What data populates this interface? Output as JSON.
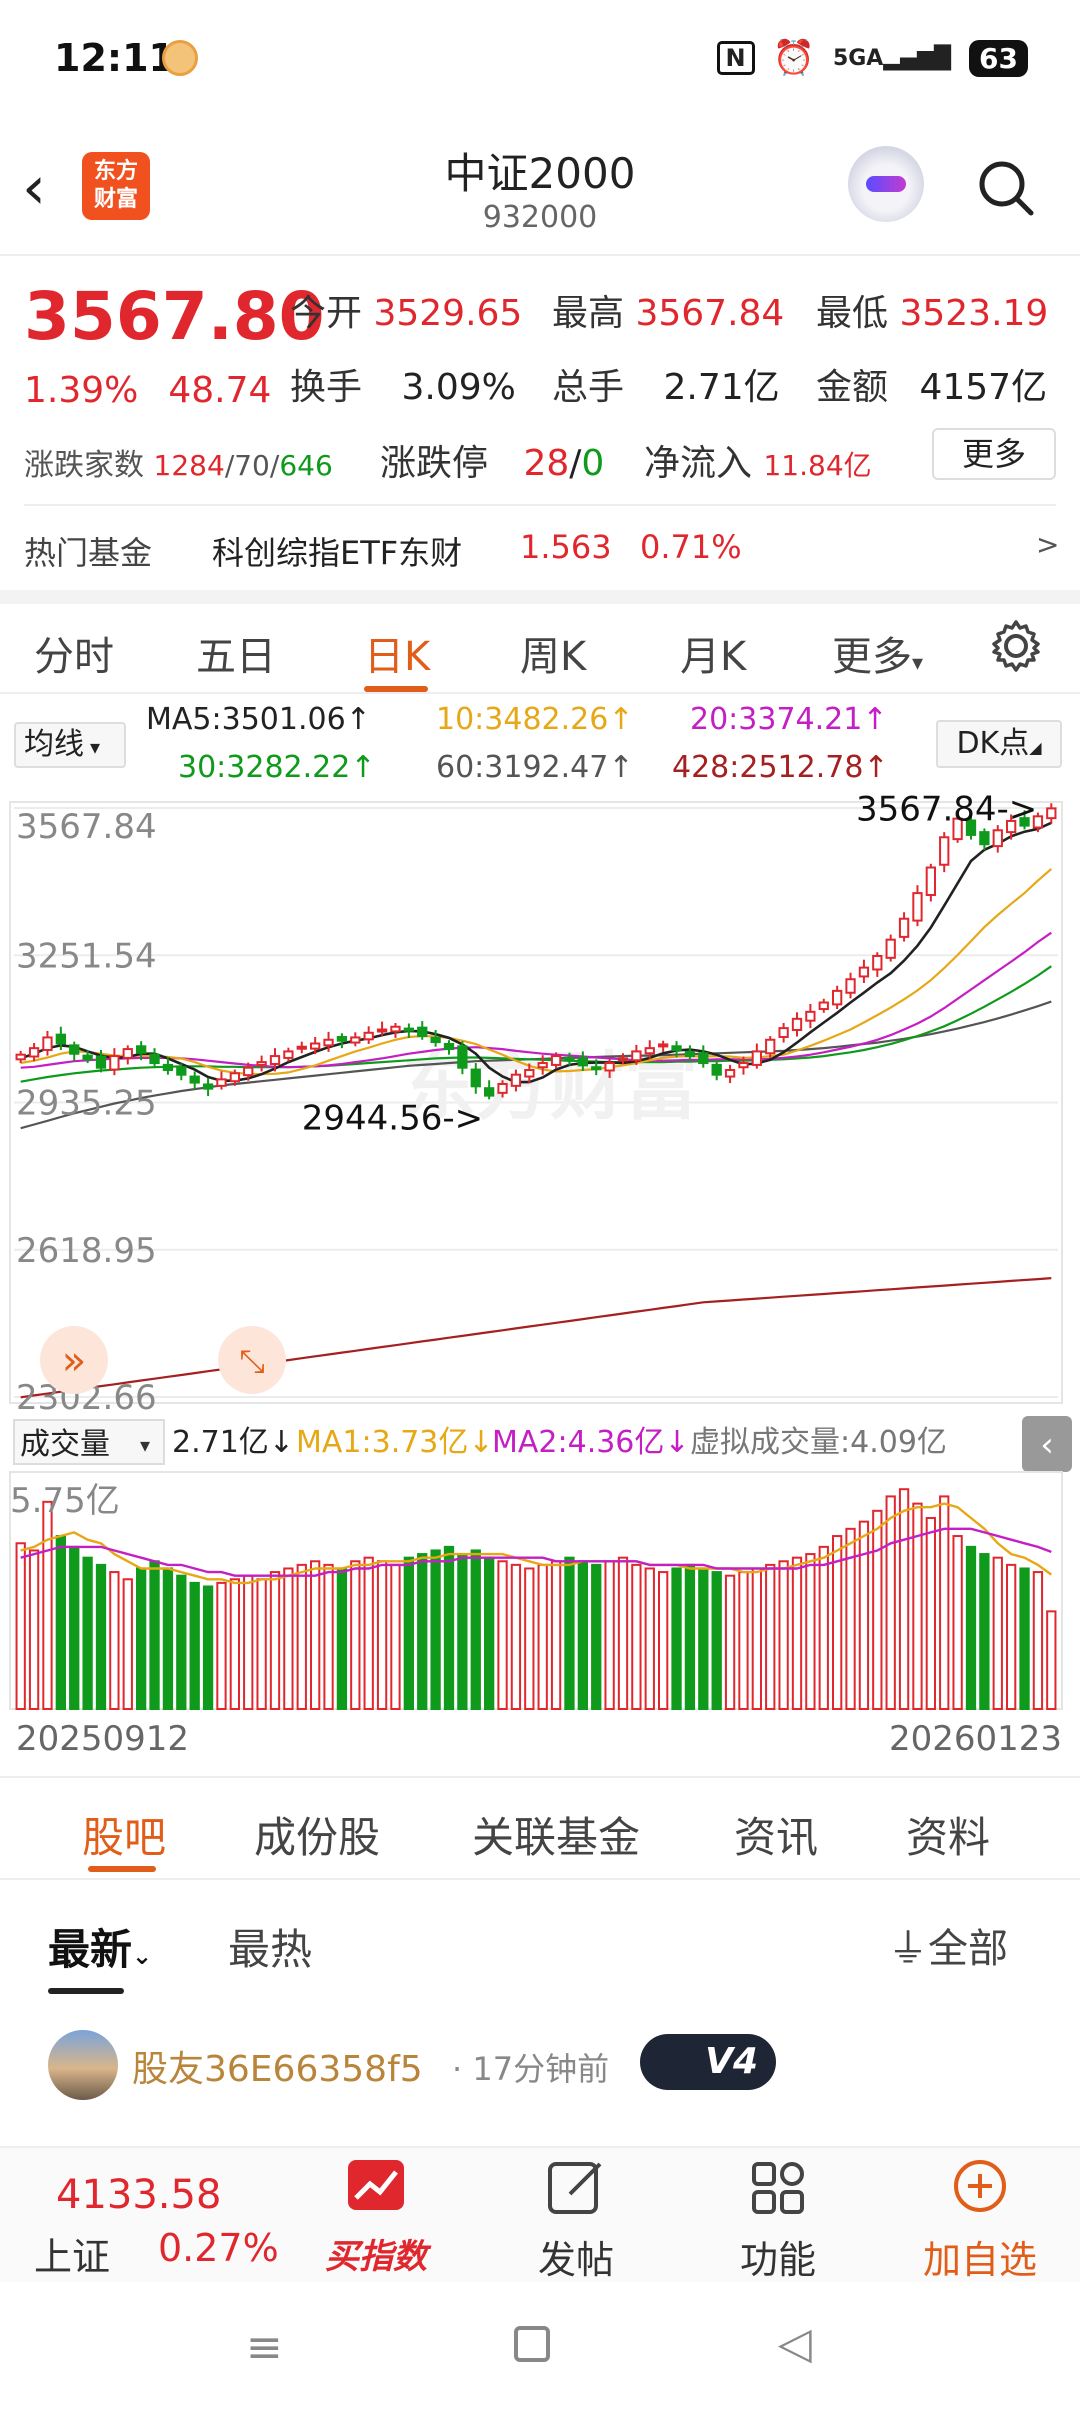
{
  "status_bar": {
    "time": "12:11",
    "icons": [
      "nfc-icon",
      "alarm-icon",
      "5g-signal-icon"
    ],
    "signal_label": "5GA",
    "battery": "63"
  },
  "header": {
    "title": "中证2000",
    "code": "932000",
    "logo_text_line1": "东方",
    "logo_text_line2": "财富"
  },
  "quote": {
    "price": "3567.80",
    "change_pct": "1.39%",
    "change_abs": "48.74",
    "open_label": "今开",
    "open": "3529.65",
    "high_label": "最高",
    "high": "3567.84",
    "low_label": "最低",
    "low": "3523.19",
    "turnover_label": "换手",
    "turnover": "3.09%",
    "volume_label": "总手",
    "volume": "2.71亿",
    "amount_label": "金额",
    "amount": "4157亿",
    "breadth_label": "涨跌家数",
    "breadth_up": "1284",
    "breadth_flat": "/70/",
    "breadth_down": "646",
    "limit_label": "涨跌停",
    "limit_up": "28",
    "limit_sep": "/",
    "limit_down": "0",
    "netflow_label": "净流入",
    "netflow": "11.84亿",
    "more_button": "更多"
  },
  "hot_fund": {
    "label": "热门基金",
    "name": "科创综指ETF东财",
    "price": "1.563",
    "change": "0.71%",
    "arrow": ">"
  },
  "chart_tabs": [
    {
      "label": "分时",
      "active": false
    },
    {
      "label": "五日",
      "active": false
    },
    {
      "label": "日K",
      "active": true
    },
    {
      "label": "周K",
      "active": false
    },
    {
      "label": "月K",
      "active": false
    },
    {
      "label": "更多",
      "active": false
    }
  ],
  "ma_row": {
    "select": "均线",
    "ma5": "MA5:3501.06↑",
    "ma10": "10:3482.26↑",
    "ma20": "20:3374.21↑",
    "ma30": "30:3282.22↑",
    "ma60": "60:3192.47↑",
    "ma428": "428:2512.78↑",
    "dk_button": "DK点",
    "colors": {
      "ma5": "#222222",
      "ma10": "#e6a817",
      "ma20": "#c41fc4",
      "ma30": "#0f9a1c",
      "ma60": "#555555",
      "ma428": "#a52020"
    }
  },
  "volume_row": {
    "select": "成交量",
    "vol": "2.71亿↓",
    "ma1": "MA1:3.73亿↓",
    "ma2": "MA2:4.36亿↓",
    "virtual": "虚拟成交量:4.09亿"
  },
  "chart_data": {
    "type": "candlestick",
    "y_ticks": [
      "3567.84",
      "3251.54",
      "2935.25",
      "2618.95",
      "2302.66"
    ],
    "ylim": [
      2302.66,
      3567.84
    ],
    "x_start": "20250912",
    "x_end": "20260123",
    "max_marker": "3567.84->",
    "min_marker": "2944.56->",
    "volume_max_label": "5.75亿",
    "watermark": "东方财富",
    "closes": [
      3038,
      3052,
      3075,
      3062,
      3040,
      3028,
      3010,
      3035,
      3050,
      3042,
      3020,
      3005,
      2995,
      2978,
      2965,
      2985,
      2998,
      3010,
      3022,
      3035,
      3045,
      3055,
      3062,
      3070,
      3068,
      3075,
      3085,
      3092,
      3098,
      3090,
      3078,
      3065,
      3050,
      3010,
      2970,
      2950,
      2975,
      2995,
      3005,
      3020,
      3035,
      3025,
      3015,
      3008,
      3020,
      3030,
      3045,
      3052,
      3060,
      3048,
      3035,
      3020,
      2995,
      3005,
      3020,
      3045,
      3070,
      3095,
      3115,
      3130,
      3150,
      3175,
      3200,
      3225,
      3250,
      3285,
      3330,
      3385,
      3440,
      3505,
      3545,
      3510,
      3490,
      3520,
      3540,
      3530,
      3550,
      3567
    ],
    "ma5": [
      3030,
      3040,
      3052,
      3058,
      3055,
      3045,
      3036,
      3031,
      3033,
      3040,
      3040,
      3030,
      3018,
      3006,
      2990,
      2982,
      2982,
      2987,
      2996,
      3008,
      3022,
      3033,
      3044,
      3054,
      3062,
      3068,
      3073,
      3080,
      3086,
      3089,
      3088,
      3082,
      3074,
      3060,
      3040,
      3010,
      2991,
      2979,
      2979,
      2989,
      3006,
      3016,
      3020,
      3021,
      3021,
      3020,
      3024,
      3031,
      3041,
      3047,
      3049,
      3045,
      3038,
      3027,
      3017,
      3019,
      3027,
      3043,
      3064,
      3086,
      3107,
      3128,
      3150,
      3171,
      3193,
      3213,
      3240,
      3272,
      3311,
      3358,
      3406,
      3454,
      3478,
      3491,
      3507,
      3517,
      3523,
      3536
    ],
    "ma10": [
      3020,
      3025,
      3032,
      3040,
      3045,
      3044,
      3040,
      3036,
      3035,
      3036,
      3035,
      3033,
      3030,
      3022,
      3012,
      3004,
      2999,
      2997,
      2996,
      2997,
      3000,
      3007,
      3015,
      3025,
      3035,
      3045,
      3053,
      3062,
      3070,
      3076,
      3078,
      3077,
      3074,
      3068,
      3061,
      3049,
      3038,
      3025,
      3014,
      3006,
      3002,
      3003,
      3005,
      3007,
      3011,
      3015,
      3020,
      3026,
      3031,
      3034,
      3035,
      3034,
      3035,
      3034,
      3031,
      3032,
      3035,
      3038,
      3047,
      3057,
      3068,
      3080,
      3092,
      3107,
      3123,
      3139,
      3157,
      3176,
      3198,
      3224,
      3252,
      3282,
      3312,
      3338,
      3362,
      3385,
      3412,
      3437
    ],
    "ma20": [
      3010,
      3012,
      3016,
      3020,
      3024,
      3026,
      3028,
      3029,
      3030,
      3031,
      3031,
      3031,
      3030,
      3028,
      3025,
      3022,
      3019,
      3016,
      3014,
      3012,
      3011,
      3012,
      3013,
      3015,
      3018,
      3022,
      3026,
      3030,
      3035,
      3040,
      3044,
      3048,
      3051,
      3053,
      3054,
      3052,
      3050,
      3046,
      3043,
      3040,
      3038,
      3036,
      3034,
      3032,
      3030,
      3028,
      3026,
      3025,
      3025,
      3026,
      3027,
      3027,
      3028,
      3028,
      3028,
      3028,
      3029,
      3031,
      3034,
      3038,
      3043,
      3049,
      3055,
      3062,
      3070,
      3080,
      3092,
      3105,
      3120,
      3138,
      3158,
      3178,
      3198,
      3218,
      3238,
      3258,
      3280,
      3300
    ],
    "ma30": [
      2980,
      2985,
      2990,
      2994,
      2998,
      3001,
      3004,
      3006,
      3008,
      3010,
      3011,
      3012,
      3013,
      3013,
      3013,
      3012,
      3012,
      3011,
      3011,
      3011,
      3011,
      3012,
      3013,
      3014,
      3016,
      3018,
      3020,
      3022,
      3024,
      3026,
      3028,
      3030,
      3031,
      3032,
      3032,
      3031,
      3030,
      3029,
      3028,
      3027,
      3026,
      3025,
      3024,
      3023,
      3022,
      3022,
      3022,
      3022,
      3022,
      3023,
      3023,
      3024,
      3024,
      3025,
      3025,
      3026,
      3027,
      3028,
      3030,
      3032,
      3035,
      3039,
      3043,
      3048,
      3054,
      3061,
      3069,
      3078,
      3088,
      3099,
      3112,
      3126,
      3141,
      3157,
      3173,
      3190,
      3208,
      3228
    ],
    "ma60": [
      2880,
      2888,
      2896,
      2904,
      2912,
      2919,
      2926,
      2933,
      2939,
      2945,
      2950,
      2955,
      2960,
      2964,
      2968,
      2972,
      2975,
      2978,
      2981,
      2984,
      2987,
      2990,
      2993,
      2996,
      2999,
      3002,
      3005,
      3008,
      3011,
      3014,
      3016,
      3018,
      3020,
      3022,
      3024,
      3025,
      3026,
      3027,
      3028,
      3029,
      3030,
      3031,
      3032,
      3033,
      3034,
      3035,
      3036,
      3036,
      3037,
      3038,
      3039,
      3040,
      3041,
      3042,
      3043,
      3044,
      3045,
      3046,
      3048,
      3050,
      3052,
      3055,
      3058,
      3061,
      3064,
      3068,
      3072,
      3077,
      3082,
      3088,
      3094,
      3101,
      3108,
      3116,
      3124,
      3133,
      3142,
      3152
    ],
    "ma428": [
      2302,
      2306,
      2310,
      2314,
      2318,
      2322,
      2326,
      2330,
      2334,
      2338,
      2342,
      2346,
      2350,
      2354,
      2358,
      2362,
      2366,
      2370,
      2374,
      2378,
      2382,
      2386,
      2390,
      2394,
      2398,
      2402,
      2406,
      2410,
      2414,
      2418,
      2422,
      2426,
      2430,
      2434,
      2438,
      2442,
      2446,
      2450,
      2454,
      2458,
      2462,
      2466,
      2470,
      2474,
      2478,
      2482,
      2486,
      2490,
      2494,
      2498,
      2502,
      2506,
      2508,
      2510,
      2512,
      2514,
      2516,
      2518,
      2520,
      2522,
      2524,
      2526,
      2528,
      2530,
      2532,
      2534,
      2536,
      2538,
      2540,
      2542,
      2544,
      2546,
      2548,
      2550,
      2552,
      2554,
      2556,
      2558
    ],
    "volumes": [
      4.6,
      4.4,
      5.75,
      4.8,
      4.5,
      4.2,
      4.0,
      3.8,
      3.6,
      3.9,
      4.1,
      3.9,
      3.7,
      3.5,
      3.4,
      3.5,
      3.6,
      3.7,
      3.6,
      3.8,
      3.9,
      4.0,
      4.1,
      4.0,
      3.9,
      4.1,
      4.2,
      4.1,
      4.0,
      4.2,
      4.3,
      4.4,
      4.5,
      4.3,
      4.4,
      4.2,
      4.1,
      4.0,
      3.9,
      4.0,
      4.1,
      4.2,
      4.1,
      4.0,
      4.1,
      4.2,
      4.0,
      3.9,
      3.8,
      3.9,
      4.0,
      3.9,
      3.8,
      3.7,
      3.8,
      3.9,
      4.0,
      4.1,
      4.2,
      4.3,
      4.5,
      4.8,
      5.0,
      5.2,
      5.5,
      5.9,
      6.1,
      5.7,
      5.3,
      5.9,
      4.8,
      4.5,
      4.3,
      4.2,
      4.0,
      3.9,
      3.8,
      2.71
    ],
    "vol_ma1": [
      4.4,
      4.5,
      4.7,
      4.8,
      4.9,
      4.7,
      4.6,
      4.3,
      4.1,
      3.9,
      3.9,
      3.9,
      3.8,
      3.7,
      3.6,
      3.6,
      3.5,
      3.5,
      3.6,
      3.6,
      3.7,
      3.8,
      3.9,
      3.9,
      3.9,
      4.0,
      4.0,
      4.1,
      4.1,
      4.1,
      4.2,
      4.2,
      4.3,
      4.3,
      4.3,
      4.3,
      4.3,
      4.2,
      4.1,
      4.0,
      4.0,
      4.0,
      4.1,
      4.1,
      4.1,
      4.1,
      4.1,
      4.0,
      4.0,
      4.0,
      3.9,
      3.9,
      3.9,
      3.9,
      3.8,
      3.8,
      3.9,
      3.9,
      4.0,
      4.1,
      4.2,
      4.4,
      4.6,
      4.8,
      5.0,
      5.3,
      5.5,
      5.6,
      5.6,
      5.7,
      5.6,
      5.3,
      5.0,
      4.6,
      4.3,
      4.2,
      4.0,
      3.73
    ],
    "vol_ma2": [
      4.2,
      4.3,
      4.4,
      4.5,
      4.5,
      4.5,
      4.5,
      4.4,
      4.3,
      4.2,
      4.1,
      4.0,
      4.0,
      3.9,
      3.8,
      3.8,
      3.7,
      3.7,
      3.7,
      3.7,
      3.7,
      3.7,
      3.7,
      3.8,
      3.8,
      3.9,
      3.9,
      4.0,
      4.0,
      4.0,
      4.1,
      4.1,
      4.1,
      4.2,
      4.2,
      4.2,
      4.2,
      4.2,
      4.2,
      4.2,
      4.1,
      4.1,
      4.1,
      4.1,
      4.1,
      4.1,
      4.1,
      4.0,
      4.0,
      4.0,
      4.0,
      4.0,
      3.9,
      3.9,
      3.9,
      3.9,
      3.9,
      3.9,
      3.9,
      4.0,
      4.0,
      4.1,
      4.2,
      4.3,
      4.4,
      4.6,
      4.7,
      4.8,
      4.9,
      5.0,
      5.0,
      5.0,
      4.9,
      4.8,
      4.7,
      4.6,
      4.5,
      4.36
    ],
    "colors": {
      "up": "#e0272d",
      "down": "#0f9a1c",
      "vol_ma1": "#e6a817",
      "vol_ma2": "#c41fc4"
    }
  },
  "section_tabs": [
    {
      "label": "股吧",
      "active": true
    },
    {
      "label": "成份股",
      "active": false
    },
    {
      "label": "关联基金",
      "active": false
    },
    {
      "label": "资讯",
      "active": false
    },
    {
      "label": "资料",
      "active": false
    }
  ],
  "filter": {
    "latest": "最新",
    "hottest": "最热",
    "all": "全部"
  },
  "post": {
    "username": "股友36E66358f5",
    "time": "· 17分钟前",
    "badge": "V4"
  },
  "bottom_nav": {
    "index_value": "4133.58",
    "index_name": "上证",
    "index_change": "0.27%",
    "buy_index": "买指数",
    "post": "发帖",
    "function": "功能",
    "add_watch": "加自选"
  }
}
